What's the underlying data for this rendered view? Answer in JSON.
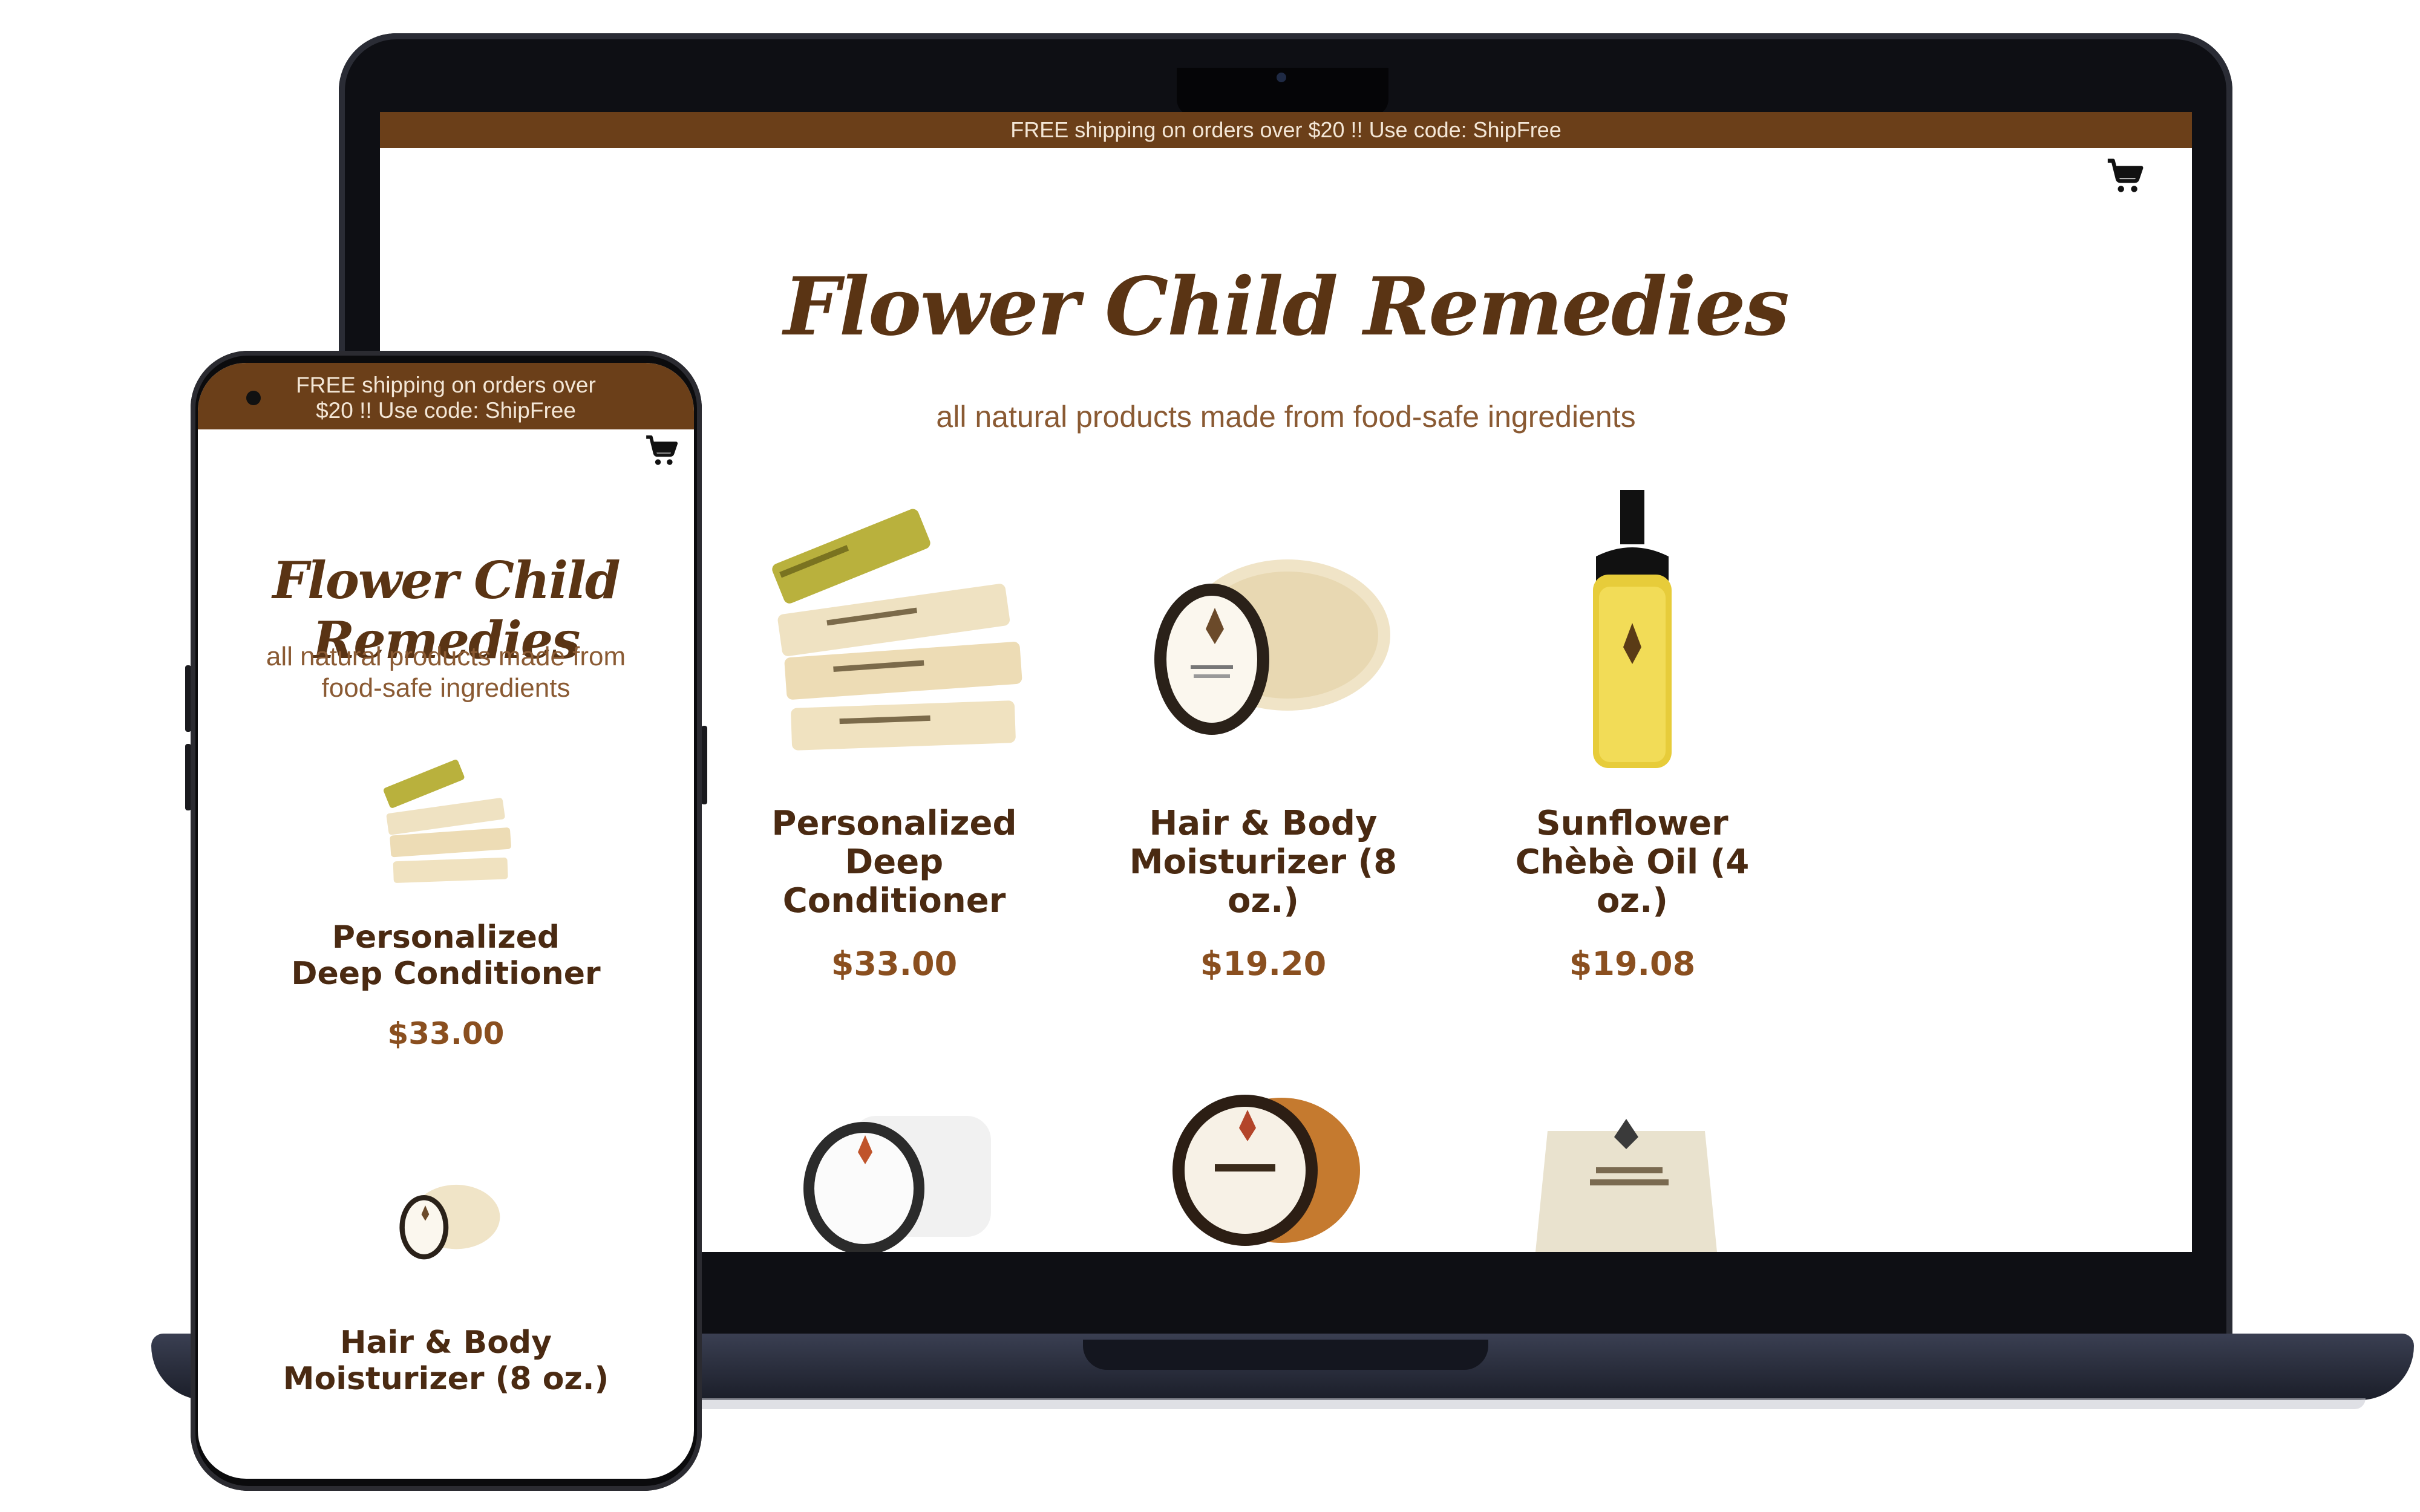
{
  "banner": {
    "text": "FREE shipping on orders over $20 !! Use code: ShipFree",
    "text_line1": "FREE shipping on orders over",
    "text_line2": "$20 !! Use code: ShipFree"
  },
  "brand": {
    "title": "Flower Child Remedies",
    "tagline": "all natural products made from food-safe ingredients",
    "tagline_line1": "all natural products made from",
    "tagline_line2": "food-safe ingredients"
  },
  "icons": {
    "cart": "shopping-cart-icon"
  },
  "products": [
    {
      "name": "Personalized Deep Conditioner",
      "price": "$33.00",
      "image": "conditioner-packets"
    },
    {
      "name": "Hair & Body Moisturizer (8 oz.)",
      "price": "$19.20",
      "image": "moisturizer-jar"
    },
    {
      "name": "Sunflower Chèbè Oil (4 oz.)",
      "price": "$19.08",
      "image": "oil-bottle"
    }
  ],
  "products_partial_row": [
    {
      "image": "cream-jar"
    },
    {
      "image": "scrub-jar"
    },
    {
      "image": "moisturizer-pouch"
    }
  ],
  "colors": {
    "banner_bg": "#6b3f19",
    "title": "#5a3414",
    "price": "#8a4f1f"
  }
}
